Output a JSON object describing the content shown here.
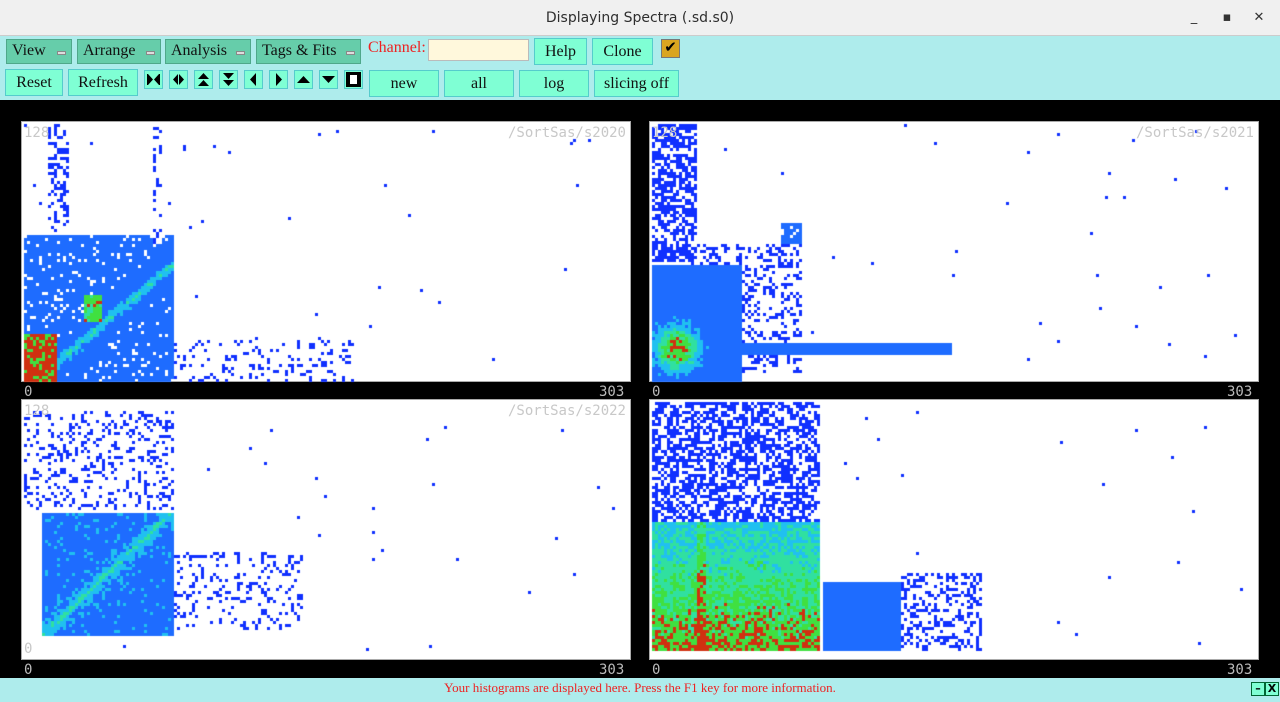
{
  "window": {
    "title": "Displaying Spectra (.sd.s0)",
    "minimize": "_",
    "maximize": "▪",
    "close": "✕"
  },
  "menus": [
    {
      "label": "View"
    },
    {
      "label": "Arrange"
    },
    {
      "label": "Analysis"
    },
    {
      "label": "Tags & Fits"
    }
  ],
  "channel": {
    "label": "Channel:",
    "value": ""
  },
  "buttons": {
    "help": "Help",
    "clone": "Clone",
    "reset": "Reset",
    "refresh": "Refresh",
    "new": "new",
    "all": "all",
    "log": "log",
    "slicing": "slicing off"
  },
  "checkbox": {
    "checked": true,
    "glyph": "✔"
  },
  "panels": [
    {
      "name": "/SortSas/s2020",
      "ymax": "128",
      "ymin": "0",
      "xmin": "0",
      "xmax": "303"
    },
    {
      "name": "/SortSas/s2021",
      "ymax": "128",
      "ymin": "0",
      "xmin": "0",
      "xmax": "303"
    },
    {
      "name": "/SortSas/s2022",
      "ymax": "128",
      "ymin": "0",
      "xmin": "0",
      "xmax": "303"
    },
    {
      "name": "",
      "ymax": "",
      "ymin": "",
      "xmin": "0",
      "xmax": "303"
    }
  ],
  "status": {
    "message": "Your histograms are displayed here. Press the F1 key for more information.",
    "minimize": "–",
    "close": "X"
  }
}
